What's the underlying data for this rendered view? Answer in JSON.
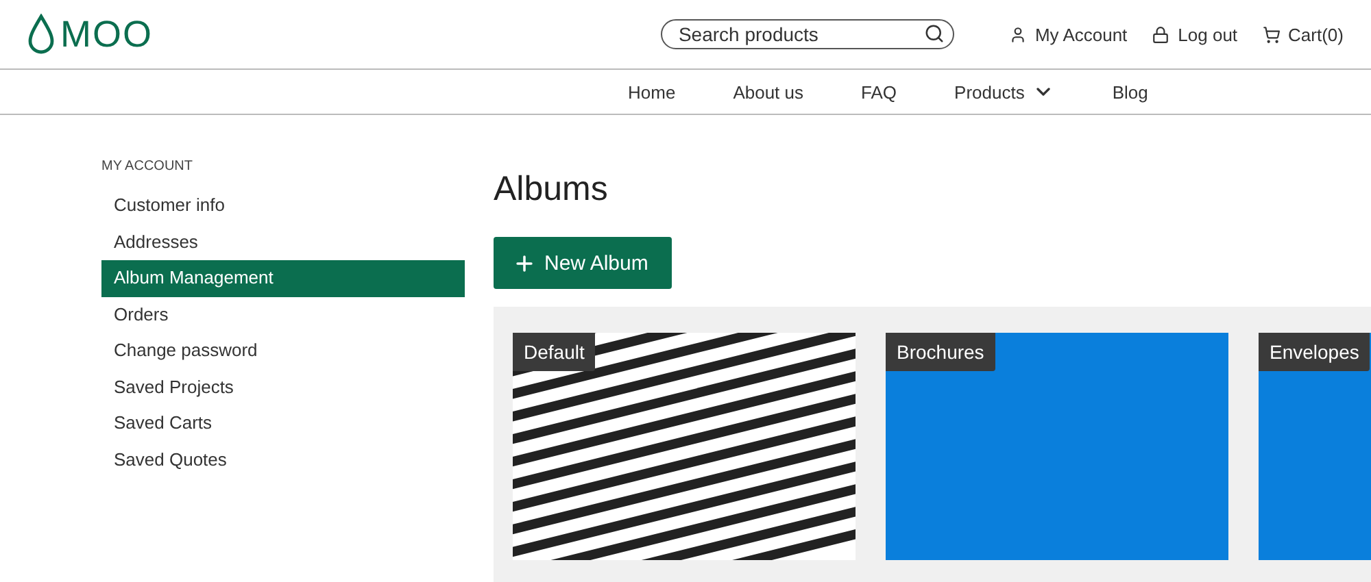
{
  "header": {
    "logo": "MOO",
    "search": {
      "placeholder": "Search products"
    },
    "links": [
      {
        "kind": "account",
        "label": "My Account"
      },
      {
        "kind": "logout",
        "label": "Log out"
      },
      {
        "kind": "cart",
        "label": "Cart(0)"
      }
    ]
  },
  "nav": [
    {
      "label": "Home",
      "dropdown": false
    },
    {
      "label": "About us",
      "dropdown": false
    },
    {
      "label": "FAQ",
      "dropdown": false
    },
    {
      "label": "Products",
      "dropdown": true
    },
    {
      "label": "Blog",
      "dropdown": false
    }
  ],
  "sidebar": {
    "heading": "MY ACCOUNT",
    "items": [
      {
        "label": "Customer info",
        "selected": false
      },
      {
        "label": "Addresses",
        "selected": false
      },
      {
        "label": "Album Management",
        "selected": true
      },
      {
        "label": "Orders",
        "selected": false
      },
      {
        "label": "Change password",
        "selected": false
      },
      {
        "label": "Saved Projects",
        "selected": false
      },
      {
        "label": "Saved Carts",
        "selected": false
      },
      {
        "label": "Saved Quotes",
        "selected": false
      }
    ]
  },
  "main": {
    "title": "Albums",
    "new_button": "New Album",
    "albums": [
      {
        "name": "Default",
        "kind": "picture"
      },
      {
        "name": "Brochures",
        "kind": "solid",
        "color": "#0a7fdc"
      },
      {
        "name": "Envelopes",
        "kind": "solid",
        "color": "#0a7fdc"
      }
    ]
  }
}
